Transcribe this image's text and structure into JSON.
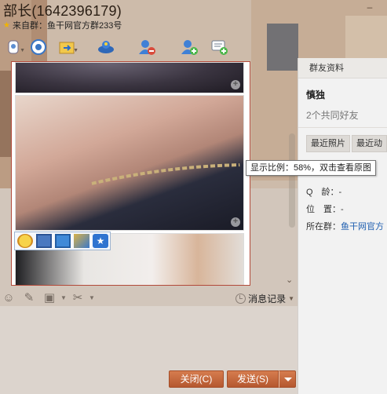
{
  "title": {
    "contact_name": "部长(1642396179)",
    "group_from": "来自群：鱼干网官方群233号"
  },
  "toolbar": {
    "icons": [
      "video-call-icon",
      "remote-assist-icon",
      "send-file-icon",
      "app-icon",
      "remove-member-icon",
      "add-member-icon",
      "new-chat-icon"
    ]
  },
  "image_tools": [
    "emoji-icon",
    "save-icon",
    "screen-icon",
    "edit-icon",
    "favorite-icon"
  ],
  "input_toolbar": {
    "history_label": "消息记录"
  },
  "buttons": {
    "close_label": "关闭(C)",
    "send_label": "发送(S)"
  },
  "tooltip": "显示比例：58%，双击查看原图",
  "right_panel": {
    "header": "群友资料",
    "name": "慎独",
    "mutual_friends": "2个共同好友",
    "tab_photos": "最近照片",
    "tab_activity": "最近动",
    "age_label": "Q　龄：-",
    "location_label": "位　置：-",
    "group_label": "所在群：",
    "group_link": "鱼干网官方"
  },
  "colors": {
    "accent_button": "#c4663a",
    "chat_border": "#b24a3a",
    "link": "#1f5fb0"
  }
}
